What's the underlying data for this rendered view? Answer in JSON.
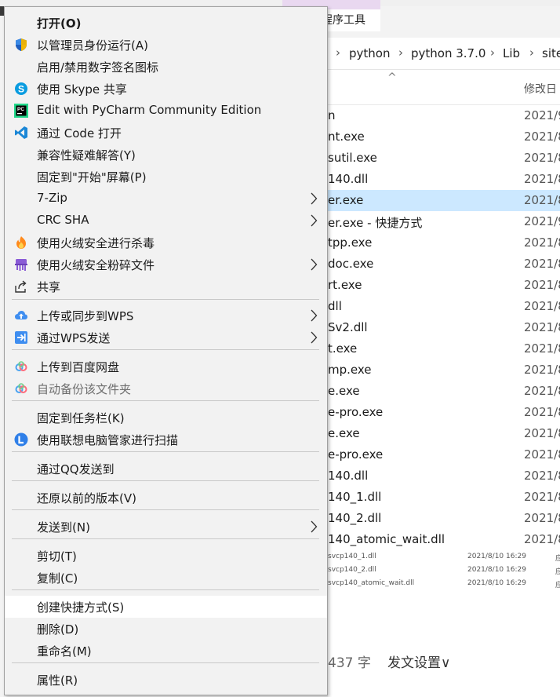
{
  "explorer": {
    "ribbon_label": "程序工具",
    "breadcrumb": [
      "python",
      "python 3.7.0",
      "Lib",
      "site"
    ],
    "col_modified": "修改日",
    "files": [
      {
        "name": "n",
        "date": "2021/9",
        "selected": false
      },
      {
        "name": "nt.exe",
        "date": "2021/8",
        "selected": false
      },
      {
        "name": "sutil.exe",
        "date": "2021/8",
        "selected": false
      },
      {
        "name": "140.dll",
        "date": "2021/8",
        "selected": false
      },
      {
        "name": "er.exe",
        "date": "2021/8",
        "selected": true
      },
      {
        "name": "er.exe - 快捷方式",
        "date": "2021/9",
        "selected": false
      },
      {
        "name": "tpp.exe",
        "date": "2021/8",
        "selected": false
      },
      {
        "name": "doc.exe",
        "date": "2021/8",
        "selected": false
      },
      {
        "name": "rt.exe",
        "date": "2021/8",
        "selected": false
      },
      {
        "name": "dll",
        "date": "2021/8",
        "selected": false
      },
      {
        "name": "Sv2.dll",
        "date": "2021/8",
        "selected": false
      },
      {
        "name": "t.exe",
        "date": "2021/8",
        "selected": false
      },
      {
        "name": "mp.exe",
        "date": "2021/8",
        "selected": false
      },
      {
        "name": "e.exe",
        "date": "2021/8",
        "selected": false
      },
      {
        "name": "e-pro.exe",
        "date": "2021/8",
        "selected": false
      },
      {
        "name": "e.exe",
        "date": "2021/8",
        "selected": false
      },
      {
        "name": "e-pro.exe",
        "date": "2021/8",
        "selected": false
      },
      {
        "name": "140.dll",
        "date": "2021/8",
        "selected": false
      },
      {
        "name": "140_1.dll",
        "date": "2021/8",
        "selected": false
      },
      {
        "name": "140_2.dll",
        "date": "2021/8",
        "selected": false
      },
      {
        "name": "140_atomic_wait.dll",
        "date": "2021/8",
        "selected": false
      }
    ],
    "mini_files": [
      {
        "name": "svcp140_1.dll",
        "date": "2021/8/10 16:29",
        "type": "应"
      },
      {
        "name": "svcp140_2.dll",
        "date": "2021/8/10 16:29",
        "type": "应"
      },
      {
        "name": "svcp140_atomic_wait.dll",
        "date": "2021/8/10 16:29",
        "type": "应"
      }
    ],
    "word_count": "437 字",
    "publish_settings": "发文设置∨"
  },
  "menu": {
    "items": [
      {
        "label": "打开(O)",
        "bold": true,
        "icon": "",
        "arrow": false,
        "dim": false
      },
      {
        "label": "以管理员身份运行(A)",
        "icon": "uac-shield-icon",
        "arrow": false
      },
      {
        "label": "启用/禁用数字签名图标",
        "icon": "",
        "arrow": false
      },
      {
        "label": "使用 Skype 共享",
        "icon": "skype-icon",
        "arrow": false
      },
      {
        "label": "Edit with PyCharm Community Edition",
        "icon": "pycharm-icon",
        "arrow": false
      },
      {
        "label": "通过 Code 打开",
        "icon": "vscode-icon",
        "arrow": false
      },
      {
        "label": "兼容性疑难解答(Y)",
        "icon": "",
        "arrow": false
      },
      {
        "label": "固定到\"开始\"屏幕(P)",
        "icon": "",
        "arrow": false
      },
      {
        "label": "7-Zip",
        "icon": "",
        "arrow": true
      },
      {
        "label": "CRC SHA",
        "icon": "",
        "arrow": true
      },
      {
        "label": "使用火绒安全进行杀毒",
        "icon": "huorong-antivirus-icon",
        "arrow": false
      },
      {
        "label": "使用火绒安全粉碎文件",
        "icon": "huorong-shredder-icon",
        "arrow": true
      },
      {
        "label": "共享",
        "icon": "share-icon",
        "arrow": false
      },
      {
        "label": "上传或同步到WPS",
        "icon": "wps-upload-icon",
        "arrow": true
      },
      {
        "label": "通过WPS发送",
        "icon": "wps-send-icon",
        "arrow": true
      },
      {
        "label": "上传到百度网盘",
        "icon": "baidu-netdisk-icon",
        "arrow": false
      },
      {
        "label": "自动备份该文件夹",
        "icon": "baidu-netdisk-icon",
        "arrow": false,
        "dim": true
      },
      {
        "label": "固定到任务栏(K)",
        "icon": "",
        "arrow": false
      },
      {
        "label": "使用联想电脑管家进行扫描",
        "icon": "lenovo-icon",
        "arrow": false
      },
      {
        "label": "通过QQ发送到",
        "icon": "",
        "arrow": false
      },
      {
        "label": "还原以前的版本(V)",
        "icon": "",
        "arrow": false
      },
      {
        "label": "发送到(N)",
        "icon": "",
        "arrow": true
      },
      {
        "label": "剪切(T)",
        "icon": "",
        "arrow": false
      },
      {
        "label": "复制(C)",
        "icon": "",
        "arrow": false
      },
      {
        "label": "创建快捷方式(S)",
        "icon": "",
        "arrow": false,
        "highlighted": true
      },
      {
        "label": "删除(D)",
        "icon": "",
        "arrow": false
      },
      {
        "label": "重命名(M)",
        "icon": "",
        "arrow": false
      },
      {
        "label": "属性(R)",
        "icon": "",
        "arrow": false
      }
    ]
  }
}
